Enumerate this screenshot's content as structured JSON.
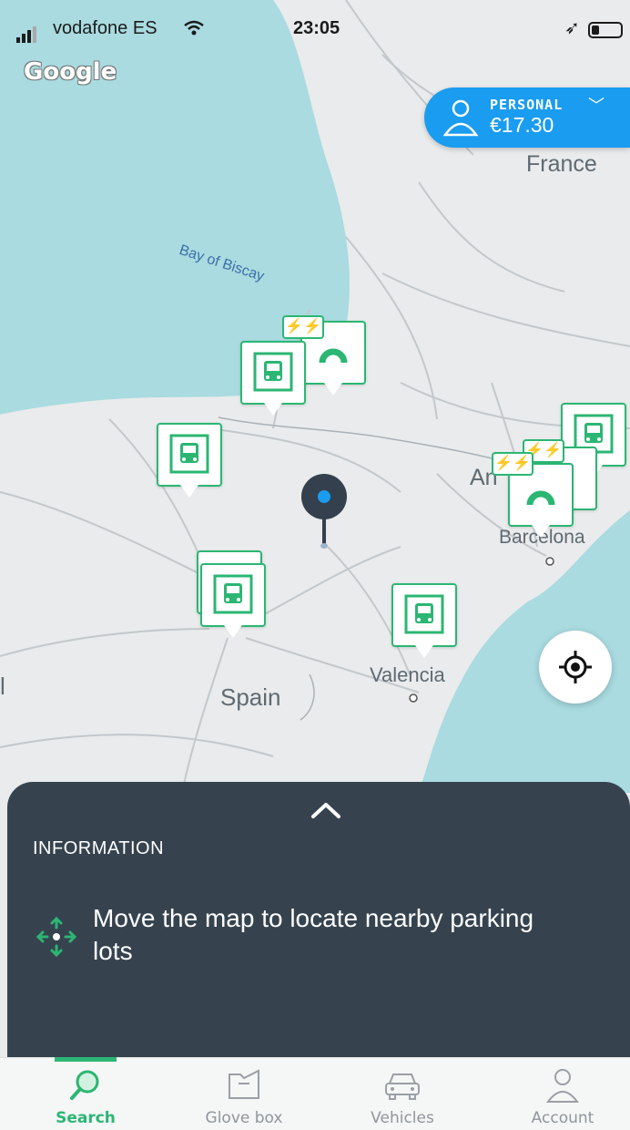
{
  "status_bar": {
    "carrier": "vodafone ES",
    "time": "23:05"
  },
  "map": {
    "provider_logo": "Google",
    "labels": {
      "france": "France",
      "bay": "Bay of Biscay",
      "andorra": "An",
      "barcelona": "Barcelona",
      "spain": "Spain",
      "valencia": "Valencia",
      "edge_letter": "l"
    },
    "marker_icons": [
      "bus-parking-icon",
      "ev-charging-icon"
    ]
  },
  "account_pill": {
    "plan": "PERSONAL",
    "balance": "€17.30"
  },
  "info_sheet": {
    "title": "INFORMATION",
    "message": "Move the map to locate nearby parking lots"
  },
  "tabs": [
    {
      "label": "Search",
      "icon": "search-icon",
      "active": true
    },
    {
      "label": "Glove box",
      "icon": "glove-box-icon",
      "active": false
    },
    {
      "label": "Vehicles",
      "icon": "car-icon",
      "active": false
    },
    {
      "label": "Account",
      "icon": "person-icon",
      "active": false
    }
  ],
  "colors": {
    "accent": "#2bb673",
    "pill": "#1a9cf0",
    "sheet": "#36434f",
    "sea": "#a9dbe0",
    "land": "#e9ebec"
  }
}
